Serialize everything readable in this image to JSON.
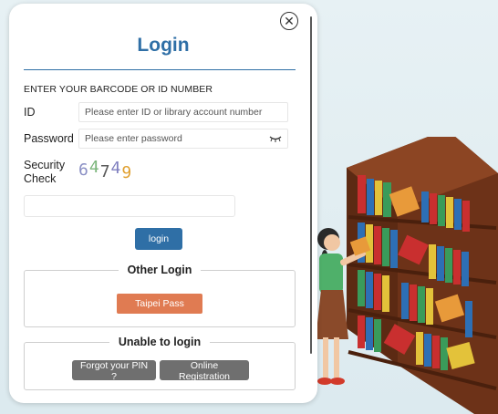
{
  "modal": {
    "title": "Login",
    "close_icon": "close-circle-icon",
    "instruction": "ENTER YOUR BARCODE OR ID NUMBER",
    "id_label": "ID",
    "id_placeholder": "Please enter ID or library account number",
    "password_label": "Password",
    "password_placeholder": "Please enter password",
    "password_toggle_icon": "eye-closed-icon",
    "security_label_line1": "Security",
    "security_label_line2": "Check",
    "captcha_digits": [
      "6",
      "4",
      "7",
      "4",
      "9"
    ],
    "captcha_colors": [
      "#8a8fc4",
      "#7ab57a",
      "#5a5a5a",
      "#7f7fbf",
      "#e0a030"
    ],
    "login_button": "login",
    "other_login": {
      "legend": "Other Login",
      "taipei_pass_button": "Taipei Pass"
    },
    "unable_to_login": {
      "legend": "Unable to login",
      "forgot_pin_button": "Forgot your PIN ?",
      "online_registration_button": "Online Registration"
    }
  },
  "colors": {
    "accent": "#2f6fa6",
    "taipei_pass": "#e07b52",
    "secondary_button": "#6f6f6f",
    "background": "#e3eef2"
  },
  "illustration": "woman-reading-at-bookshelf-illustration"
}
